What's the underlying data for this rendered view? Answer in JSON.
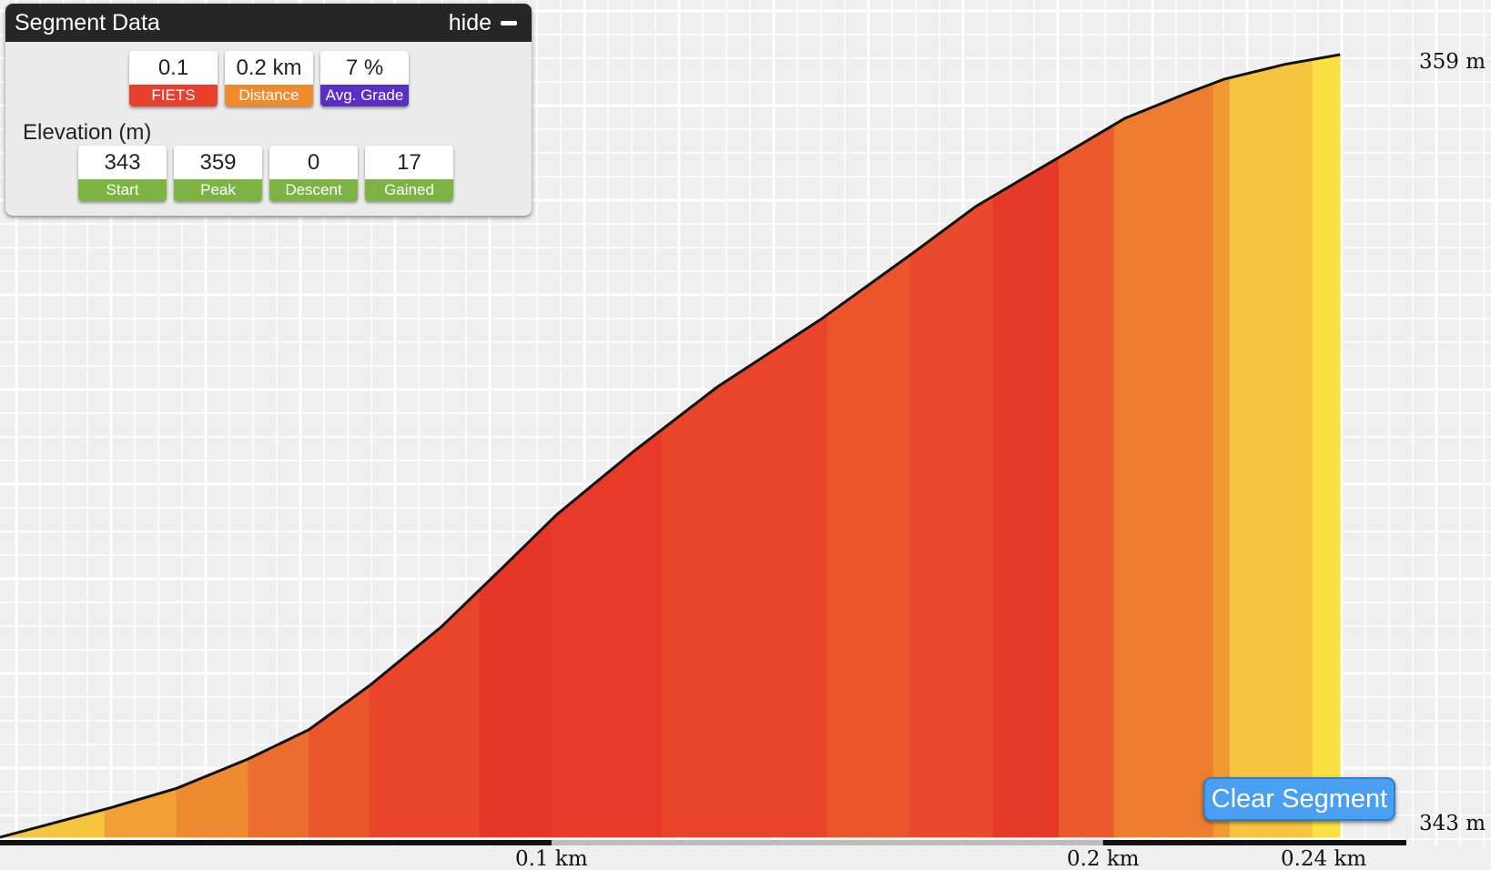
{
  "panel": {
    "title": "Segment Data",
    "hide_label": "hide",
    "stats": [
      {
        "value": "0.1",
        "label": "FIETS",
        "color": "#e8402c"
      },
      {
        "value": "0.2 km",
        "label": "Distance",
        "color": "#ef8a2e"
      },
      {
        "value": "7 %",
        "label": "Avg. Grade",
        "color": "#5a2fc6"
      }
    ],
    "elevation_title": "Elevation (m)",
    "elevation_stats": [
      {
        "value": "343",
        "label": "Start"
      },
      {
        "value": "359",
        "label": "Peak"
      },
      {
        "value": "0",
        "label": "Descent"
      },
      {
        "value": "17",
        "label": "Gained"
      }
    ],
    "elevation_color": "#7cb342"
  },
  "clear_button": "Clear Segment",
  "chart_data": {
    "type": "area",
    "x_unit": "km",
    "xlim": [
      0,
      0.255
    ],
    "ylim": [
      343,
      359
    ],
    "x_ticks": [
      {
        "value": 0.1,
        "label": "0.1 km"
      },
      {
        "value": 0.2,
        "label": "0.2 km"
      },
      {
        "value": 0.24,
        "label": "0.24 km"
      }
    ],
    "y_ticks": [
      {
        "value": 343,
        "label": "343 m"
      },
      {
        "value": 359,
        "label": "359 m"
      }
    ],
    "profile": {
      "x": [
        0,
        0.01,
        0.02,
        0.032,
        0.045,
        0.056,
        0.067,
        0.08,
        0.091,
        0.101,
        0.115,
        0.13,
        0.149,
        0.165,
        0.177,
        0.192,
        0.204,
        0.215,
        0.222,
        0.233,
        0.243
      ],
      "y": [
        343.0,
        343.3,
        343.6,
        344.0,
        344.6,
        345.2,
        346.1,
        347.3,
        348.5,
        349.6,
        350.9,
        352.2,
        353.6,
        354.9,
        355.9,
        356.9,
        357.7,
        358.2,
        358.5,
        358.8,
        359.0
      ]
    },
    "grade_segments": [
      {
        "x0": 0,
        "x1": 0.019,
        "color": "#f5c540"
      },
      {
        "x0": 0.019,
        "x1": 0.032,
        "color": "#f1a035"
      },
      {
        "x0": 0.032,
        "x1": 0.045,
        "color": "#ee8a30"
      },
      {
        "x0": 0.045,
        "x1": 0.056,
        "color": "#ec6e2e"
      },
      {
        "x0": 0.056,
        "x1": 0.067,
        "color": "#ea572c"
      },
      {
        "x0": 0.067,
        "x1": 0.087,
        "color": "#e8452a"
      },
      {
        "x0": 0.087,
        "x1": 0.1,
        "color": "#e63628"
      },
      {
        "x0": 0.1,
        "x1": 0.12,
        "color": "#e73a29"
      },
      {
        "x0": 0.12,
        "x1": 0.15,
        "color": "#e8452a"
      },
      {
        "x0": 0.15,
        "x1": 0.165,
        "color": "#ea552c"
      },
      {
        "x0": 0.165,
        "x1": 0.18,
        "color": "#ea4a2b"
      },
      {
        "x0": 0.18,
        "x1": 0.192,
        "color": "#e63a28"
      },
      {
        "x0": 0.192,
        "x1": 0.202,
        "color": "#ea5a2c"
      },
      {
        "x0": 0.202,
        "x1": 0.22,
        "color": "#ee7d30"
      },
      {
        "x0": 0.22,
        "x1": 0.223,
        "color": "#f19a35"
      },
      {
        "x0": 0.223,
        "x1": 0.238,
        "color": "#f5c540"
      },
      {
        "x0": 0.238,
        "x1": 0.243,
        "color": "#fbe043"
      }
    ],
    "selection": {
      "x0": 0.1,
      "x1": 0.2
    },
    "grid": true
  }
}
